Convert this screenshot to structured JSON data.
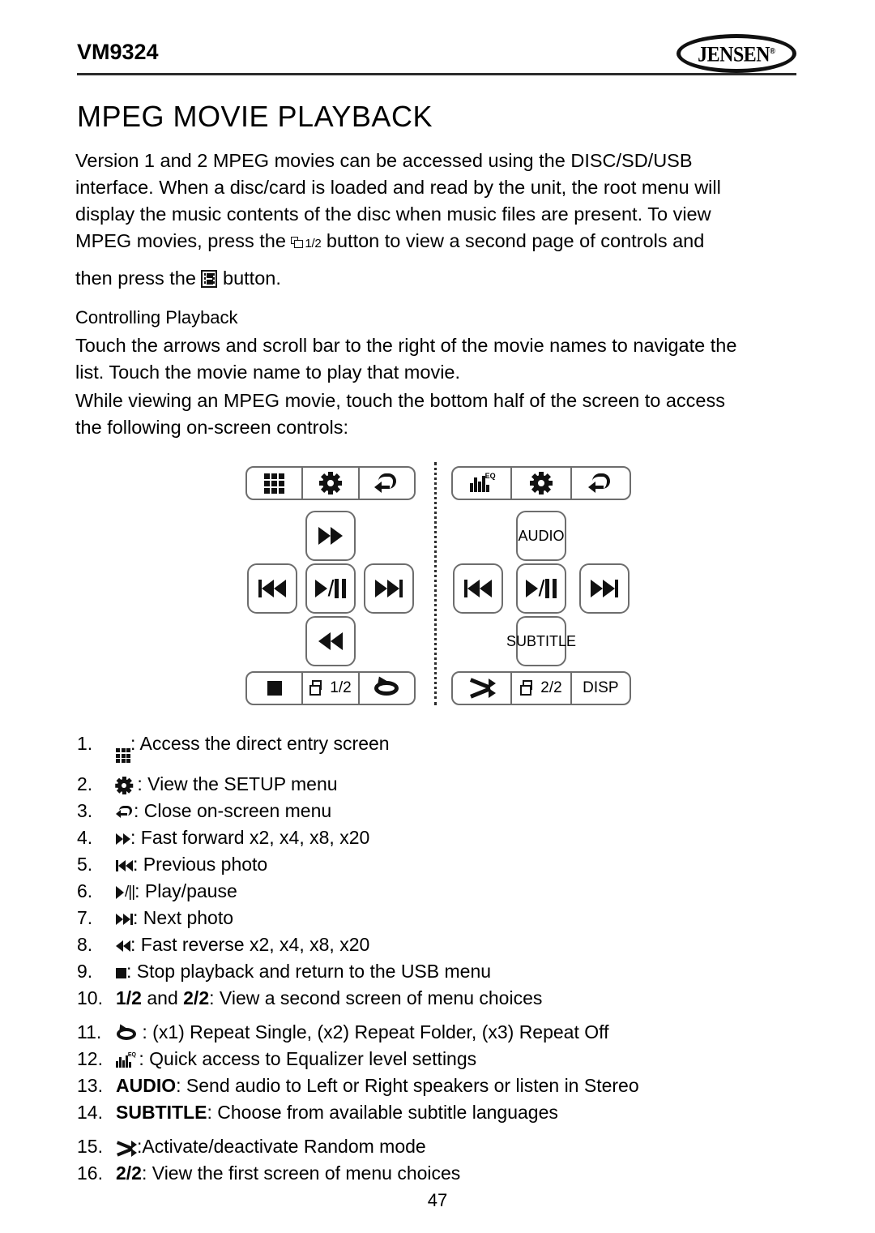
{
  "header": {
    "model": "VM9324",
    "logo_text": "JENSEN",
    "logo_registered": "®"
  },
  "title": "MPEG MOVIE PLAYBACK",
  "paragraphs": {
    "intro_lines": [
      "Version 1 and 2 MPEG movies can be accessed using the DISC/SD/USB",
      "interface. When a disc/card is loaded and read by the unit, the root menu will",
      "display the music contents of the disc when music files are present. To view"
    ],
    "intro_line4_before": "MPEG movies, press the",
    "intro_line4_icon_label": "1/2",
    "intro_line4_after": "button to view a second page of controls and",
    "intro_line5_before": "then press the",
    "intro_line5_after": "button.",
    "subhead": "Controlling Playback",
    "controlling_lines": [
      "Touch the arrows and scroll bar to the right of the movie names to navigate the",
      "list. Touch the movie name to play that movie."
    ],
    "viewing_lines": [
      "While viewing an MPEG movie, touch the bottom half of the screen to access",
      "the following on-screen controls:"
    ]
  },
  "panel_left": {
    "top_bar": [
      {
        "icon": "grid-icon",
        "label": ""
      },
      {
        "icon": "gear-icon",
        "label": ""
      },
      {
        "icon": "return-icon",
        "label": ""
      }
    ],
    "up_button": {
      "icon": "fast-forward-icon",
      "label": ""
    },
    "prev_button": {
      "icon": "previous-track-icon",
      "label": ""
    },
    "play_button": {
      "icon": "play-pause-icon",
      "label": ""
    },
    "next_button": {
      "icon": "next-track-icon",
      "label": ""
    },
    "down_button": {
      "icon": "fast-reverse-icon",
      "label": ""
    },
    "bottom_bar": [
      {
        "icon": "stop-icon",
        "label": ""
      },
      {
        "icon": "pages-icon",
        "label": "1/2"
      },
      {
        "icon": "repeat-icon",
        "label": ""
      }
    ]
  },
  "panel_right": {
    "top_bar": [
      {
        "icon": "equalizer-icon",
        "label": "EQ"
      },
      {
        "icon": "gear-icon",
        "label": ""
      },
      {
        "icon": "return-icon",
        "label": ""
      }
    ],
    "up_button": {
      "icon": "",
      "label": "AUDIO"
    },
    "prev_button": {
      "icon": "previous-track-icon",
      "label": ""
    },
    "play_button": {
      "icon": "play-pause-icon",
      "label": ""
    },
    "next_button": {
      "icon": "next-track-icon",
      "label": ""
    },
    "down_button": {
      "icon": "",
      "label_line1": "SUB",
      "label_line2": "TITLE"
    },
    "bottom_bar": [
      {
        "icon": "shuffle-icon",
        "label": ""
      },
      {
        "icon": "pages-icon",
        "label": "2/2"
      },
      {
        "icon": "",
        "label": "DISP"
      }
    ]
  },
  "list": [
    {
      "num": "1.",
      "icon": "grid-icon",
      "text": ": Access the direct entry screen"
    },
    {
      "num": "2.",
      "icon": "gear-icon",
      "text": " : View the SETUP menu"
    },
    {
      "num": "3.",
      "icon": "return-icon",
      "text": ": Close on-screen menu"
    },
    {
      "num": "4.",
      "icon": "fast-forward-icon",
      "text": ": Fast forward x2, x4, x8, x20"
    },
    {
      "num": "5.",
      "icon": "previous-track-icon",
      "text": ": Previous photo"
    },
    {
      "num": "6.",
      "icon": "play-pause-icon",
      "text": ": Play/pause"
    },
    {
      "num": "7.",
      "icon": "next-track-icon",
      "text": ": Next photo"
    },
    {
      "num": "8.",
      "icon": "fast-reverse-icon",
      "text": ": Fast reverse x2, x4, x8, x20"
    },
    {
      "num": "9.",
      "icon": "stop-icon",
      "text": ": Stop playback and return to the USB menu"
    },
    {
      "num": "10.",
      "icon": "",
      "bold1": "1/2",
      "mid": " and ",
      "bold2": "2/2",
      "text": ": View a second screen of menu choices"
    },
    {
      "num": "11.",
      "icon": "repeat-icon",
      "text": " : (x1) Repeat Single, (x2) Repeat Folder, (x3) Repeat Off"
    },
    {
      "num": "12.",
      "icon": "equalizer-icon",
      "text": " : Quick access to Equalizer level settings"
    },
    {
      "num": "13.",
      "icon": "",
      "bold1": "AUDIO",
      "text": ": Send audio to Left or Right speakers or listen in Stereo"
    },
    {
      "num": "14.",
      "icon": "",
      "bold1": "SUBTITLE",
      "text": ": Choose from available subtitle languages"
    },
    {
      "num": "15.",
      "icon": "shuffle-icon",
      "text": ":Activate/deactivate Random mode"
    },
    {
      "num": "16.",
      "icon": "",
      "bold1": "2/2",
      "text": ": View the first screen of menu choices"
    }
  ],
  "footer": {
    "page_number": "47"
  },
  "colors": {
    "ink": "#000000",
    "rule": "#2b2b2b",
    "button_outline": "#6d6d6d"
  }
}
